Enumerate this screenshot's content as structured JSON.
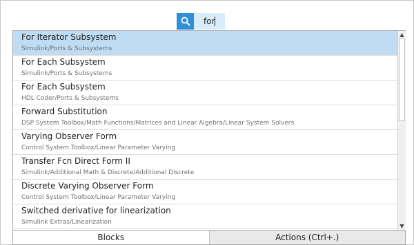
{
  "search": {
    "value": "for"
  },
  "results": [
    {
      "name": "For Iterator Subsystem",
      "path": "Simulink/Ports & Subsystems",
      "selected": true
    },
    {
      "name": "For Each Subsystem",
      "path": "Simulink/Ports & Subsystems",
      "selected": false
    },
    {
      "name": "For Each Subsystem",
      "path": "HDL Coder/Ports & Subsystems",
      "selected": false
    },
    {
      "name": "Forward Substitution",
      "path": "DSP System Toolbox/Math Functions/Matrices and Linear Algebra/Linear System Solvers",
      "selected": false
    },
    {
      "name": "Varying Observer Form",
      "path": "Control System Toolbox/Linear Parameter Varying",
      "selected": false
    },
    {
      "name": "Transfer Fcn Direct Form II",
      "path": "Simulink/Additional Math & Discrete/Additional Discrete",
      "selected": false
    },
    {
      "name": "Discrete Varying Observer Form",
      "path": "Control System Toolbox/Linear Parameter Varying",
      "selected": false
    },
    {
      "name": "Switched derivative for linearization",
      "path": "Simulink Extras/Linearization",
      "selected": false
    }
  ],
  "tabs": [
    {
      "label": "Blocks",
      "active": true
    },
    {
      "label": "Actions (Ctrl+.)",
      "active": false
    }
  ],
  "icons": {
    "search": "search-icon",
    "scroll_up": "arrow-up-icon",
    "scroll_down": "arrow-down-icon"
  },
  "colors": {
    "accent": "#2f8fd8",
    "selected_row": "#bfdcf3",
    "search_field": "#d9ecfa"
  }
}
